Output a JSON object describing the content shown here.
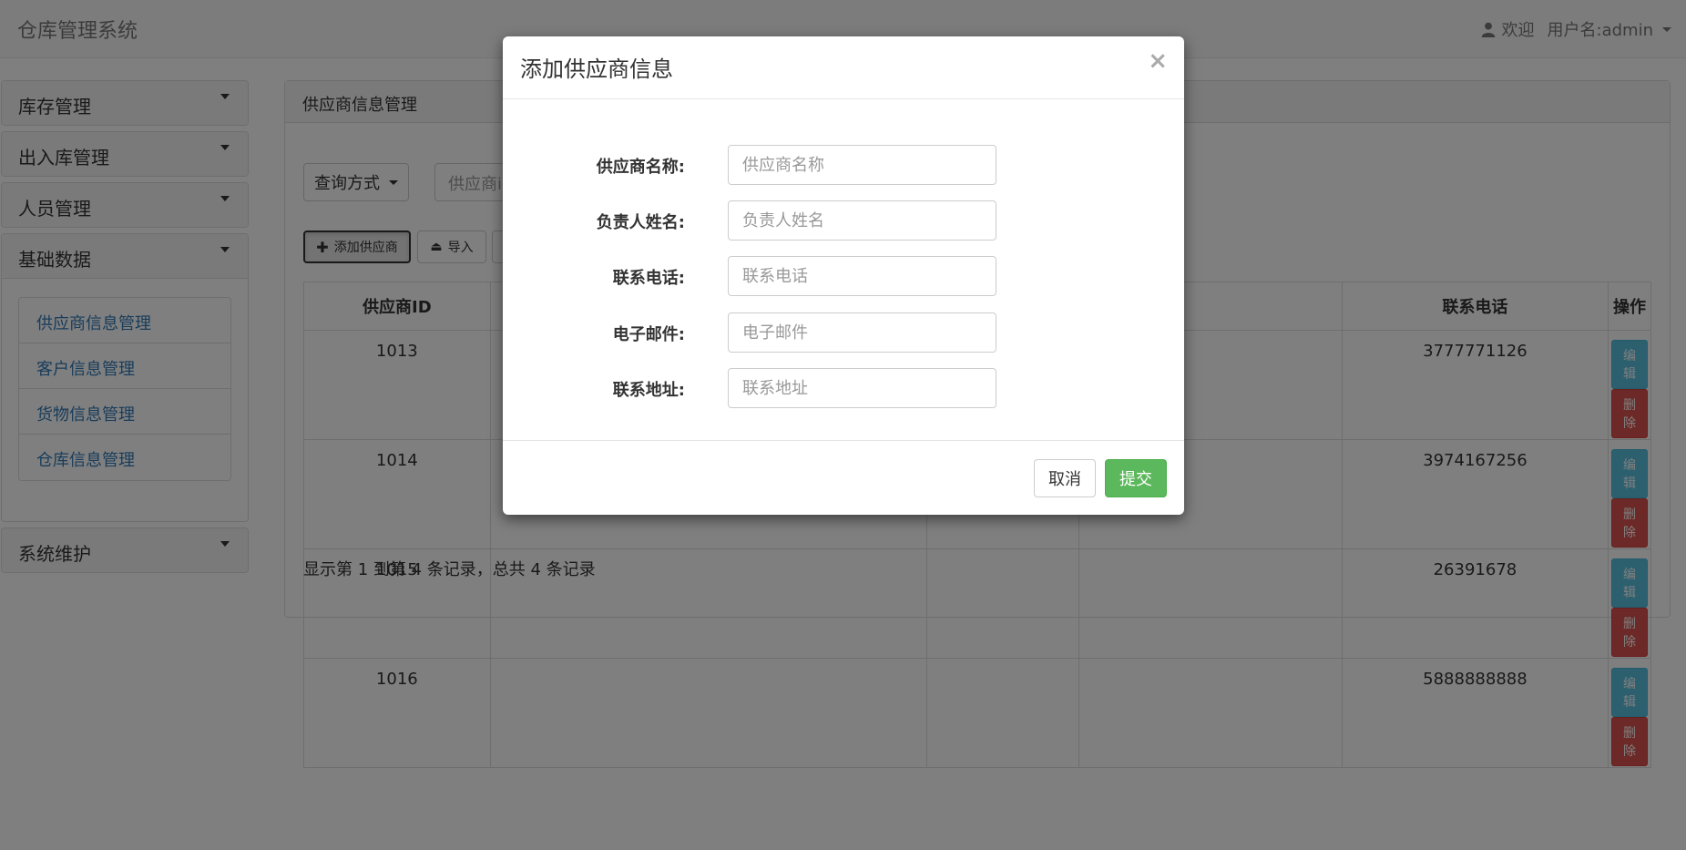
{
  "app": {
    "title": "仓库管理系统",
    "welcome": "欢迎",
    "username_label": "用户名:admin"
  },
  "sidebar": {
    "menus": [
      {
        "label": "库存管理"
      },
      {
        "label": "出入库管理"
      },
      {
        "label": "人员管理"
      },
      {
        "label": "基础数据",
        "items": [
          "供应商信息管理",
          "客户信息管理",
          "货物信息管理",
          "仓库信息管理"
        ]
      },
      {
        "label": "系统维护"
      }
    ]
  },
  "main": {
    "panel_title": "供应商信息管理",
    "query_mode_label": "查询方式",
    "search_placeholder": "供应商i",
    "add_button": "添加供应商",
    "import_button": "导入",
    "table": {
      "headers": [
        "供应商ID",
        "",
        "",
        "",
        "联系电话",
        "操作"
      ],
      "rows": [
        {
          "id": "1013",
          "phone": "3777771126"
        },
        {
          "id": "1014",
          "phone": "3974167256"
        },
        {
          "id": "1015",
          "phone": "26391678"
        },
        {
          "id": "1016",
          "phone": "5888888888"
        }
      ],
      "edit_label": "编辑",
      "delete_label": "删除"
    },
    "pager_info": "显示第 1 到第 4 条记录，总共 4 条记录"
  },
  "modal": {
    "title": "添加供应商信息",
    "close_symbol": "×",
    "fields": [
      {
        "label": "供应商名称:",
        "placeholder": "供应商名称"
      },
      {
        "label": "负责人姓名:",
        "placeholder": "负责人姓名"
      },
      {
        "label": "联系电话:",
        "placeholder": "联系电话"
      },
      {
        "label": "电子邮件:",
        "placeholder": "电子邮件"
      },
      {
        "label": "联系地址:",
        "placeholder": "联系地址"
      }
    ],
    "cancel_label": "取消",
    "submit_label": "提交"
  },
  "colors": {
    "primary_link": "#337ab7",
    "success": "#5cb85c",
    "info": "#5bc0de",
    "danger": "#d9534f"
  }
}
